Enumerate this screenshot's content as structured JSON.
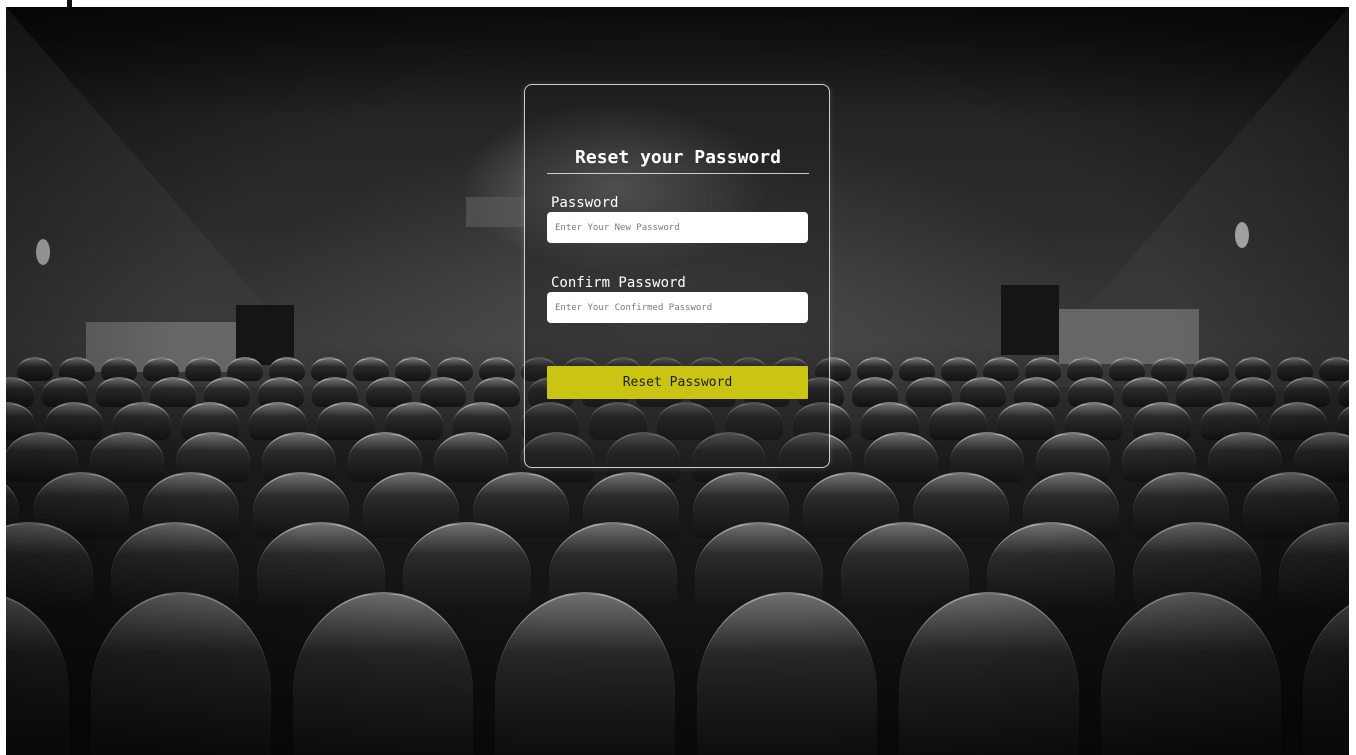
{
  "reset_form": {
    "title": "Reset your Password",
    "password": {
      "label": "Password",
      "value": "",
      "placeholder": "Enter Your New Password"
    },
    "confirm_password": {
      "label": "Confirm Password",
      "value": "",
      "placeholder": "Enter Your Confirmed Password"
    },
    "submit_label": "Reset Password"
  },
  "colors": {
    "button_accent": "#c9c512",
    "card_border": "#ebebeb",
    "title_text": "#ffffff"
  }
}
